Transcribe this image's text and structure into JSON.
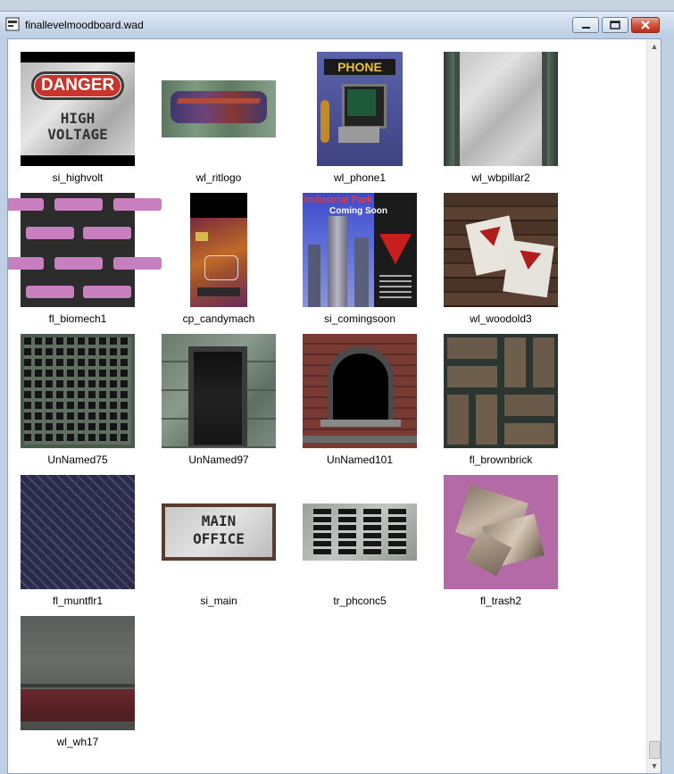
{
  "window": {
    "title": "finallevelmoodboard.wad",
    "app_icon": "wad-file-icon",
    "controls": {
      "minimize": "minimize-icon",
      "maximize": "maximize-icon",
      "close": "close-icon"
    }
  },
  "colors": {
    "title_bg": "#c9d8ea",
    "close_red": "#d1523b",
    "content_bg": "#ffffff"
  },
  "textures": [
    {
      "name": "si_highvolt",
      "sign_top": "DANGER",
      "sign_bottom_1": "HIGH",
      "sign_bottom_2": "VOLTAGE"
    },
    {
      "name": "wl_ritlogo"
    },
    {
      "name": "wl_phone1",
      "sign": "PHONE"
    },
    {
      "name": "wl_wbpillar2"
    },
    {
      "name": "fl_biomech1"
    },
    {
      "name": "cp_candymach"
    },
    {
      "name": "si_comingsoon",
      "line1": "Industrial Park",
      "line2": "Coming Soon"
    },
    {
      "name": "wl_woodold3"
    },
    {
      "name": "UnNamed75"
    },
    {
      "name": "UnNamed97"
    },
    {
      "name": "UnNamed101"
    },
    {
      "name": "fl_brownbrick"
    },
    {
      "name": "fl_muntflr1"
    },
    {
      "name": "si_main",
      "line1": "MAIN",
      "line2": "OFFICE"
    },
    {
      "name": "tr_phconc5"
    },
    {
      "name": "fl_trash2"
    },
    {
      "name": "wl_wh17"
    }
  ]
}
